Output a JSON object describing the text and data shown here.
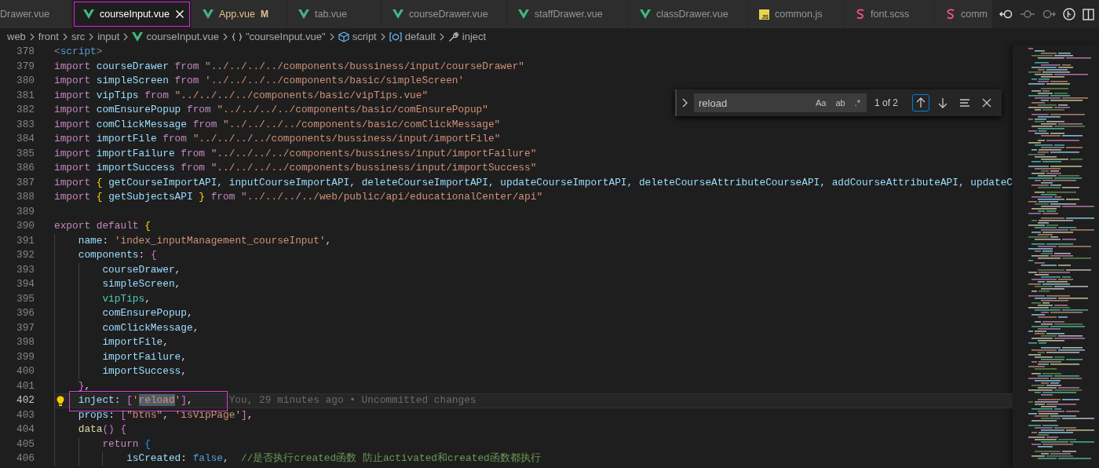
{
  "tabs": [
    {
      "label": "Drawer.vue",
      "kind": "plain",
      "selected": false,
      "framed": false
    },
    {
      "label": "courseInput.vue",
      "kind": "vue",
      "selected": true,
      "framed": true
    },
    {
      "label": "App.vue",
      "kind": "vue",
      "selected": false,
      "framed": false,
      "status": "M"
    },
    {
      "label": "tab.vue",
      "kind": "vue",
      "selected": false,
      "framed": false
    },
    {
      "label": "courseDrawer.vue",
      "kind": "vue",
      "selected": false,
      "framed": false
    },
    {
      "label": "staffDrawer.vue",
      "kind": "vue",
      "selected": false,
      "framed": false
    },
    {
      "label": "classDrawer.vue",
      "kind": "vue",
      "selected": false,
      "framed": false
    },
    {
      "label": "common.js",
      "kind": "js",
      "icon_label": "JS",
      "selected": false,
      "framed": false
    },
    {
      "label": "font.scss",
      "kind": "scss",
      "selected": false,
      "framed": false
    },
    {
      "label": "comm",
      "kind": "scss",
      "selected": false,
      "framed": false
    }
  ],
  "breadcrumb": [
    {
      "text": "web",
      "kind": "folder"
    },
    {
      "text": "front",
      "kind": "folder"
    },
    {
      "text": "src",
      "kind": "folder"
    },
    {
      "text": "input",
      "kind": "folder"
    },
    {
      "text": "courseInput.vue",
      "kind": "vue"
    },
    {
      "text": "\"courseInput.vue\"",
      "kind": "braces"
    },
    {
      "text": "script",
      "kind": "cube"
    },
    {
      "text": "default",
      "kind": "module"
    },
    {
      "text": "inject",
      "kind": "wrench"
    }
  ],
  "find": {
    "value": "reload",
    "options": [
      {
        "label": "Aa",
        "on": false
      },
      {
        "label": "ab",
        "on": false
      },
      {
        "label": ".*",
        "on": false
      }
    ],
    "result": "1 of 2",
    "buttons": [
      {
        "kind": "previous",
        "focused": true
      },
      {
        "kind": "next",
        "focused": false
      },
      {
        "kind": "selection",
        "focused": false
      },
      {
        "kind": "close",
        "focused": false
      }
    ]
  },
  "lines": [
    {
      "number": "378",
      "current": false,
      "framed": false,
      "tokens": [
        {
          "kind": "tag",
          "text": "<"
        },
        {
          "kind": "tagname",
          "text": "script"
        },
        {
          "kind": "tag",
          "text": ">"
        }
      ]
    },
    {
      "number": "379",
      "current": false,
      "framed": false,
      "tokens": [
        {
          "kind": "kw",
          "text": "import "
        },
        {
          "kind": "var",
          "text": "courseDrawer "
        },
        {
          "kind": "kw",
          "text": "from "
        },
        {
          "kind": "str",
          "text": "\"../../../../components/bussiness/input/courseDrawer\""
        }
      ]
    },
    {
      "number": "380",
      "current": false,
      "framed": false,
      "tokens": [
        {
          "kind": "kw",
          "text": "import "
        },
        {
          "kind": "var",
          "text": "simpleScreen "
        },
        {
          "kind": "kw",
          "text": "from "
        },
        {
          "kind": "str",
          "text": "'../../../../components/basic/simpleScreen'"
        }
      ]
    },
    {
      "number": "381",
      "current": false,
      "framed": false,
      "tokens": [
        {
          "kind": "kw",
          "text": "import "
        },
        {
          "kind": "var",
          "text": "vipTips "
        },
        {
          "kind": "kw",
          "text": "from "
        },
        {
          "kind": "str",
          "text": "\"../../../../components/basic/vipTips.vue\""
        }
      ]
    },
    {
      "number": "382",
      "current": false,
      "framed": false,
      "tokens": [
        {
          "kind": "kw",
          "text": "import "
        },
        {
          "kind": "var",
          "text": "comEnsurePopup "
        },
        {
          "kind": "kw",
          "text": "from "
        },
        {
          "kind": "str",
          "text": "\"../../../../components/basic/comEnsurePopup\""
        }
      ]
    },
    {
      "number": "383",
      "current": false,
      "framed": false,
      "tokens": [
        {
          "kind": "kw",
          "text": "import "
        },
        {
          "kind": "var",
          "text": "comClickMessage "
        },
        {
          "kind": "kw",
          "text": "from "
        },
        {
          "kind": "str",
          "text": "\"../../../../components/basic/comClickMessage\""
        }
      ]
    },
    {
      "number": "384",
      "current": false,
      "framed": false,
      "tokens": [
        {
          "kind": "kw",
          "text": "import "
        },
        {
          "kind": "var",
          "text": "importFile "
        },
        {
          "kind": "kw",
          "text": "from "
        },
        {
          "kind": "str",
          "text": "\"../../../../components/bussiness/input/importFile\""
        }
      ]
    },
    {
      "number": "385",
      "current": false,
      "framed": false,
      "tokens": [
        {
          "kind": "kw",
          "text": "import "
        },
        {
          "kind": "var",
          "text": "importFailure "
        },
        {
          "kind": "kw",
          "text": "from "
        },
        {
          "kind": "str",
          "text": "\"../../../../components/bussiness/input/importFailure\""
        }
      ]
    },
    {
      "number": "386",
      "current": false,
      "framed": false,
      "tokens": [
        {
          "kind": "kw",
          "text": "import "
        },
        {
          "kind": "var",
          "text": "importSuccess "
        },
        {
          "kind": "kw",
          "text": "from "
        },
        {
          "kind": "str",
          "text": "\"../../../../components/bussiness/input/importSuccess\""
        }
      ]
    },
    {
      "number": "387",
      "current": false,
      "framed": false,
      "tokens": [
        {
          "kind": "kw",
          "text": "import "
        },
        {
          "kind": "br1",
          "text": "{ "
        },
        {
          "kind": "var",
          "text": "getCourseImportAPI, inputCourseImportAPI, deleteCourseImportAPI, updateCourseImportAPI, deleteCourseAttributeCourseAPI, addCourseAttributeAPI, updateC"
        }
      ]
    },
    {
      "number": "388",
      "current": false,
      "framed": false,
      "tokens": [
        {
          "kind": "kw",
          "text": "import "
        },
        {
          "kind": "br1",
          "text": "{ "
        },
        {
          "kind": "var",
          "text": "getSubjectsAPI "
        },
        {
          "kind": "br1",
          "text": "} "
        },
        {
          "kind": "kw",
          "text": "from "
        },
        {
          "kind": "str",
          "text": "\"../../../../web/public/api/educationalCenter/api\""
        }
      ]
    },
    {
      "number": "389",
      "current": false,
      "framed": false
    },
    {
      "number": "390",
      "current": false,
      "framed": false,
      "tokens": [
        {
          "kind": "kw",
          "text": "export default "
        },
        {
          "kind": "br1",
          "text": "{"
        }
      ]
    },
    {
      "number": "391",
      "current": false,
      "framed": false,
      "tokens": [
        {
          "kind": "var",
          "text": "    name"
        },
        {
          "kind": "punct",
          "text": ": "
        },
        {
          "kind": "str",
          "text": "'index_inputManagement_courseInput'"
        },
        {
          "kind": "punct",
          "text": ","
        }
      ]
    },
    {
      "number": "392",
      "current": false,
      "framed": false,
      "tokens": [
        {
          "kind": "var",
          "text": "    components"
        },
        {
          "kind": "punct",
          "text": ": "
        },
        {
          "kind": "br2",
          "text": "{"
        }
      ]
    },
    {
      "number": "393",
      "current": false,
      "framed": false,
      "tokens": [
        {
          "kind": "var",
          "text": "        courseDrawer"
        },
        {
          "kind": "punct",
          "text": ","
        }
      ]
    },
    {
      "number": "394",
      "current": false,
      "framed": false,
      "tokens": [
        {
          "kind": "var",
          "text": "        simpleScreen"
        },
        {
          "kind": "punct",
          "text": ","
        }
      ]
    },
    {
      "number": "395",
      "current": false,
      "framed": false,
      "tokens": [
        {
          "kind": "type",
          "text": "        vipTips"
        },
        {
          "kind": "punct",
          "text": ","
        }
      ]
    },
    {
      "number": "396",
      "current": false,
      "framed": false,
      "tokens": [
        {
          "kind": "var",
          "text": "        comEnsurePopup"
        },
        {
          "kind": "punct",
          "text": ","
        }
      ]
    },
    {
      "number": "397",
      "current": false,
      "framed": false,
      "tokens": [
        {
          "kind": "var",
          "text": "        comClickMessage"
        },
        {
          "kind": "punct",
          "text": ","
        }
      ]
    },
    {
      "number": "398",
      "current": false,
      "framed": false,
      "tokens": [
        {
          "kind": "var",
          "text": "        importFile"
        },
        {
          "kind": "punct",
          "text": ","
        }
      ]
    },
    {
      "number": "399",
      "current": false,
      "framed": false,
      "tokens": [
        {
          "kind": "var",
          "text": "        importFailure"
        },
        {
          "kind": "punct",
          "text": ","
        }
      ]
    },
    {
      "number": "400",
      "current": false,
      "framed": false,
      "tokens": [
        {
          "kind": "var",
          "text": "        importSuccess"
        },
        {
          "kind": "punct",
          "text": ","
        }
      ]
    },
    {
      "number": "401",
      "current": false,
      "framed": false,
      "tokens": [
        {
          "kind": "br2",
          "text": "    }"
        },
        {
          "kind": "punct",
          "text": ","
        }
      ]
    },
    {
      "number": "402",
      "current": true,
      "framed": true,
      "blame": "You, 29 minutes ago • Uncommitted changes",
      "tokens": [
        {
          "kind": "var",
          "text": "    inject"
        },
        {
          "kind": "punct",
          "text": ": "
        },
        {
          "kind": "br2",
          "text": "["
        },
        {
          "kind": "str",
          "text": "'"
        },
        {
          "kind": "match",
          "text": "reload"
        },
        {
          "kind": "str",
          "text": "'"
        },
        {
          "kind": "br2",
          "text": "]"
        },
        {
          "kind": "punct",
          "text": ","
        }
      ]
    },
    {
      "number": "403",
      "current": false,
      "framed": false,
      "tokens": [
        {
          "kind": "var",
          "text": "    props"
        },
        {
          "kind": "punct",
          "text": ": "
        },
        {
          "kind": "br2",
          "text": "["
        },
        {
          "kind": "str",
          "text": "\"btns\""
        },
        {
          "kind": "punct",
          "text": ", "
        },
        {
          "kind": "str",
          "text": "'isVipPage'"
        },
        {
          "kind": "br2",
          "text": "]"
        },
        {
          "kind": "punct",
          "text": ","
        }
      ]
    },
    {
      "number": "404",
      "current": false,
      "framed": false,
      "tokens": [
        {
          "kind": "fn",
          "text": "    data"
        },
        {
          "kind": "br2",
          "text": "() {"
        }
      ]
    },
    {
      "number": "405",
      "current": false,
      "framed": false,
      "tokens": [
        {
          "kind": "kw",
          "text": "        return "
        },
        {
          "kind": "br3",
          "text": "{"
        }
      ]
    },
    {
      "number": "406",
      "current": false,
      "framed": false,
      "tokens": [
        {
          "kind": "var",
          "text": "            isCreated"
        },
        {
          "kind": "punct",
          "text": ": "
        },
        {
          "kind": "const",
          "text": "false"
        },
        {
          "kind": "punct",
          "text": ",  "
        },
        {
          "kind": "comment",
          "text": "//是否执行created函数 防止activated和created函数都执行"
        }
      ]
    }
  ]
}
